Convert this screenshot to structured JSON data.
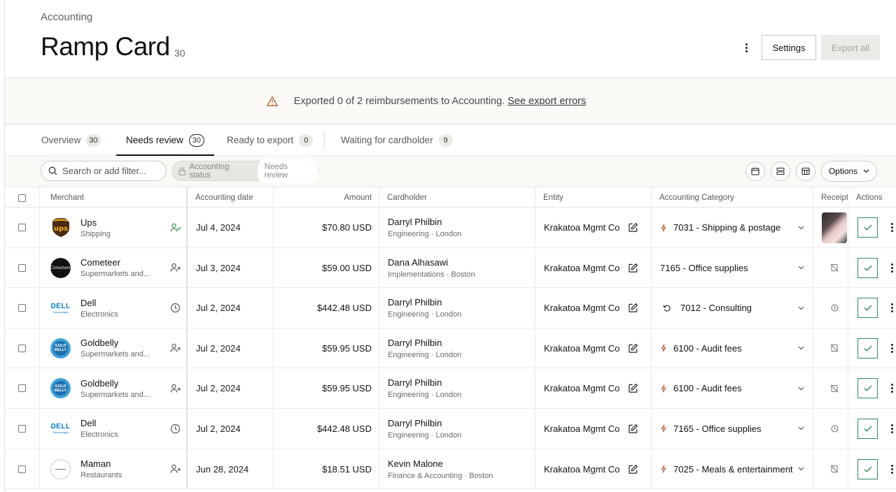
{
  "breadcrumb": "Accounting",
  "title": "Ramp Card",
  "title_count": "30",
  "header_buttons": {
    "settings": "Settings",
    "export_all": "Export all"
  },
  "banner": {
    "text": "Exported 0 of 2 reimbursements to Accounting.",
    "link": "See export errors"
  },
  "tabs": [
    {
      "label": "Overview",
      "count": "30"
    },
    {
      "label": "Needs review",
      "count": "30"
    },
    {
      "label": "Ready to export",
      "count": "0"
    },
    {
      "label": "Waiting for cardholder",
      "count": "9"
    }
  ],
  "active_tab": 1,
  "filter": {
    "search_placeholder": "Search or add filter...",
    "chip_label": "Accounting status",
    "chip_value": "Needs review",
    "options_label": "Options"
  },
  "columns": {
    "merchant": "Merchant",
    "date": "Accounting date",
    "amount": "Amount",
    "cardholder": "Cardholder",
    "entity": "Entity",
    "category": "Accounting Category",
    "receipt": "Receipt",
    "actions": "Actions"
  },
  "rows": [
    {
      "merchant": "Ups",
      "sub": "Shipping",
      "logo": "ups",
      "status_icon": "user-check-icon",
      "date": "Jul 4, 2024",
      "amount": "$70.80 USD",
      "cardholder": "Darryl Philbin",
      "dept": "Engineering · London",
      "entity": "Krakatoa Mgmt Co",
      "cat_icon": "bolt-icon",
      "category": "7031 - Shipping & postage",
      "receipt": "image"
    },
    {
      "merchant": "Cometeer",
      "sub": "Supermarkets and...",
      "logo": "cometeer",
      "status_icon": "user-x-icon",
      "date": "Jul 3, 2024",
      "amount": "$59.00 USD",
      "cardholder": "Dana Alhasawi",
      "dept": "Implementations · Boston",
      "entity": "Krakatoa Mgmt Co",
      "cat_icon": "",
      "category": "7165 - Office supplies",
      "receipt": "missing"
    },
    {
      "merchant": "Dell",
      "sub": "Electronics",
      "logo": "dell",
      "status_icon": "clock-icon",
      "date": "Jul 2, 2024",
      "amount": "$442.48 USD",
      "cardholder": "Darryl Philbin",
      "dept": "Engineering · London",
      "entity": "Krakatoa Mgmt Co",
      "cat_icon": "undo-icon",
      "category": "7012 - Consulting",
      "receipt": "pending"
    },
    {
      "merchant": "Goldbelly",
      "sub": "Supermarkets and...",
      "logo": "goldbelly",
      "status_icon": "user-x-icon",
      "date": "Jul 2, 2024",
      "amount": "$59.95 USD",
      "cardholder": "Darryl Philbin",
      "dept": "Engineering · London",
      "entity": "Krakatoa Mgmt Co",
      "cat_icon": "bolt-icon",
      "category": "6100 - Audit fees",
      "receipt": "missing"
    },
    {
      "merchant": "Goldbelly",
      "sub": "Supermarkets and...",
      "logo": "goldbelly",
      "status_icon": "user-x-icon",
      "date": "Jul 2, 2024",
      "amount": "$59.95 USD",
      "cardholder": "Darryl Philbin",
      "dept": "Engineering · London",
      "entity": "Krakatoa Mgmt Co",
      "cat_icon": "bolt-icon",
      "category": "6100 - Audit fees",
      "receipt": "missing"
    },
    {
      "merchant": "Dell",
      "sub": "Electronics",
      "logo": "dell",
      "status_icon": "clock-icon",
      "date": "Jul 2, 2024",
      "amount": "$442.48 USD",
      "cardholder": "Darryl Philbin",
      "dept": "Engineering · London",
      "entity": "Krakatoa Mgmt Co",
      "cat_icon": "bolt-icon",
      "category": "7165 - Office supplies",
      "receipt": "pending"
    },
    {
      "merchant": "Maman",
      "sub": "Restaurants",
      "logo": "maman",
      "status_icon": "user-x-icon",
      "date": "Jun 28, 2024",
      "amount": "$18.51 USD",
      "cardholder": "Kevin Malone",
      "dept": "Finance & Accounting · Boston",
      "entity": "Krakatoa Mgmt Co",
      "cat_icon": "bolt-icon",
      "category": "7025 - Meals & entertainment",
      "receipt": "missing"
    }
  ],
  "colors": {
    "approve_green": "#2e8b57",
    "warning": "#b5612e",
    "banner_bg": "#faf9f6"
  },
  "logo_text": {
    "ups": "ups",
    "dell": "DELL",
    "dell_sub": "Technologies",
    "goldbelly": "GOLD BELLY",
    "cometeer": "Cometeer"
  }
}
